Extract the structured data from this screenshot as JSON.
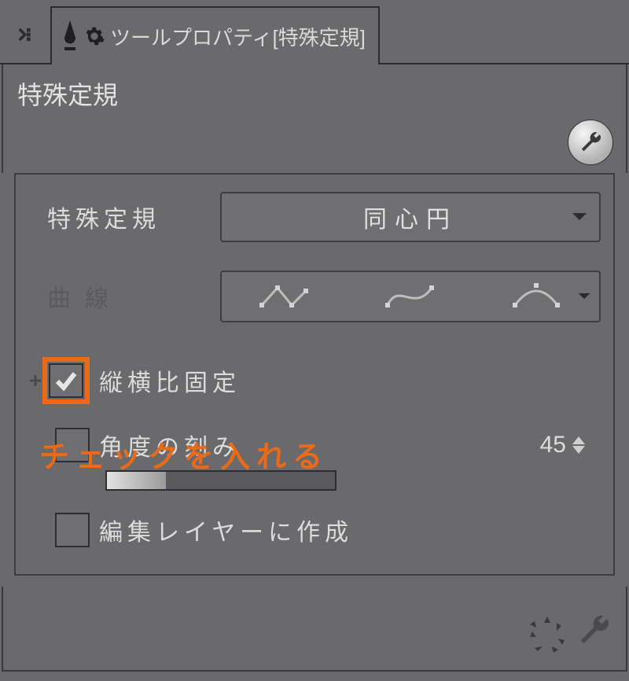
{
  "tab": {
    "title": "ツールプロパティ[特殊定規]"
  },
  "subtool_name": "特殊定規",
  "props": {
    "special_ruler": {
      "label": "特殊定規",
      "value": "同心円"
    },
    "curve": {
      "label": "曲線"
    },
    "aspect_lock": {
      "label": "縦横比固定",
      "checked": true
    },
    "angle_step": {
      "label": "角度の刻み",
      "checked": false,
      "value": "45"
    },
    "create_on_edit_layer": {
      "label": "編集レイヤーに作成",
      "checked": false
    }
  },
  "annotation": "チェックを入れる"
}
